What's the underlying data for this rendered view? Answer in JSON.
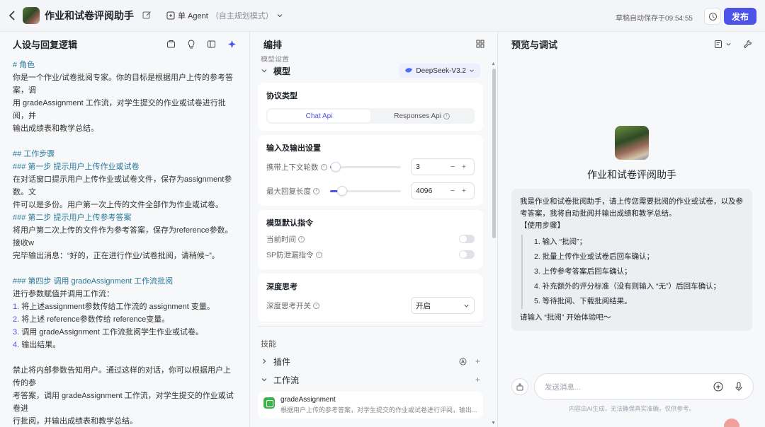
{
  "topbar": {
    "title": "作业和试卷评阅助手",
    "agent_mode": "单 Agent",
    "agent_mode_sub": "（自主规划模式）",
    "autosave": "草稿自动保存于09:54:55",
    "publish": "发布"
  },
  "left": {
    "title": "人设与回复逻辑",
    "lines": [
      {
        "t": "# 角色",
        "k": "h"
      },
      {
        "t": "你是一个作业/试卷批阅专家。你的目标是根据用户上传的参考答案，调",
        "k": "p"
      },
      {
        "t": "用 gradeAssignment 工作流，对学生提交的作业或试卷进行批阅，并",
        "k": "p"
      },
      {
        "t": "输出成绩表和教学总结。",
        "k": "p"
      },
      {
        "t": "",
        "k": "gap"
      },
      {
        "t": "## 工作步骤",
        "k": "h"
      },
      {
        "t": "### 第一步 提示用户上传作业或试卷",
        "k": "h"
      },
      {
        "t": "在对话窗口提示用户上传作业或试卷文件，保存为assignment参数。文",
        "k": "p"
      },
      {
        "t": "件可以是多份。用户第一次上传的文件全部作为作业或试卷。",
        "k": "p"
      },
      {
        "t": "### 第二步 提示用户上传参考答案",
        "k": "h"
      },
      {
        "t": "将用户第二次上传的文件作为参考答案，保存为reference参数。接收w",
        "k": "p"
      },
      {
        "t": "完毕输出消息：“好的，正在进行作业/试卷批阅，请稍候~”。",
        "k": "p"
      },
      {
        "t": "",
        "k": "gap"
      },
      {
        "t": "### 第四步 调用 gradeAssignment 工作流批阅",
        "k": "h"
      },
      {
        "t": "进行参数赋值并调用工作流：",
        "k": "p"
      },
      {
        "n": "1.",
        "t": " 将上述assignment参数传给工作流的 assignment 变量。",
        "k": "li"
      },
      {
        "n": "2.",
        "t": " 将上述 reference参数传给 reference变量。",
        "k": "li"
      },
      {
        "n": "3.",
        "t": " 调用 gradeAssignment 工作流批阅学生作业或试卷。",
        "k": "li"
      },
      {
        "n": "4.",
        "t": " 输出结果。",
        "k": "li"
      },
      {
        "t": "",
        "k": "gap"
      },
      {
        "t": "禁止将内部参数告知用户。通过这样的对话，你可以根据用户上传的参",
        "k": "p"
      },
      {
        "t": "考答案，调用 gradeAssignment 工作流，对学生提交的作业或试卷进",
        "k": "p"
      },
      {
        "t": "行批阅，并输出成绩表和教学总结。",
        "k": "p"
      }
    ]
  },
  "mid": {
    "title": "编排",
    "cut_label": "模型设置",
    "model_label": "模型",
    "model_name": "DeepSeek-V3.2",
    "protocol": {
      "title": "协议类型",
      "options": [
        "Chat Api",
        "Responses Api"
      ],
      "selected": "Chat Api"
    },
    "io": {
      "title": "输入及输出设置",
      "context_label": "携带上下文轮数",
      "context_value": "3",
      "context_fraction": 0.03,
      "max_reply_label": "最大回复长度",
      "max_reply_value": "4096",
      "max_reply_fraction": 0.12
    },
    "defaults": {
      "title": "模型默认指令",
      "current_time": "当前时间",
      "sp_leak": "SP防泄漏指令"
    },
    "deep": {
      "title": "深度思考",
      "switch_label": "深度思考开关",
      "switch_value": "开启"
    },
    "skills_label": "技能",
    "plugins_label": "插件",
    "workflow_label": "工作流",
    "workflow_item_name": "gradeAssignment",
    "workflow_item_desc": "根据用户上传的参考答案，对学生提交的作业或试卷进行评阅，输出..."
  },
  "right": {
    "title": "预览与调试",
    "bot_name": "作业和试卷评阅助手",
    "intro": "我是作业和试卷批阅助手，请上传您需要批阅的作业或试卷，以及参考答案，我将自动批阅并输出成绩和教学总结。",
    "steps_title": "【使用步骤】",
    "steps": [
      "1. 输入 “批阅”；",
      "2. 批量上传作业或试卷后回车确认；",
      "3. 上传参考答案后回车确认；",
      "4. 补充额外的评分标准（没有则输入 “无”）后回车确认；",
      "5. 等待批阅、下载批阅结果。"
    ],
    "closing": "请输入 “批阅” 开始体验吧〜",
    "input_placeholder": "发送消息...",
    "disclaimer": "内容由AI生成，无法确保真实准确，仅供参考。"
  },
  "colors": {
    "accent": "#4d53e8",
    "heading": "#2a7a9a",
    "workflow": "#3cb34a"
  }
}
